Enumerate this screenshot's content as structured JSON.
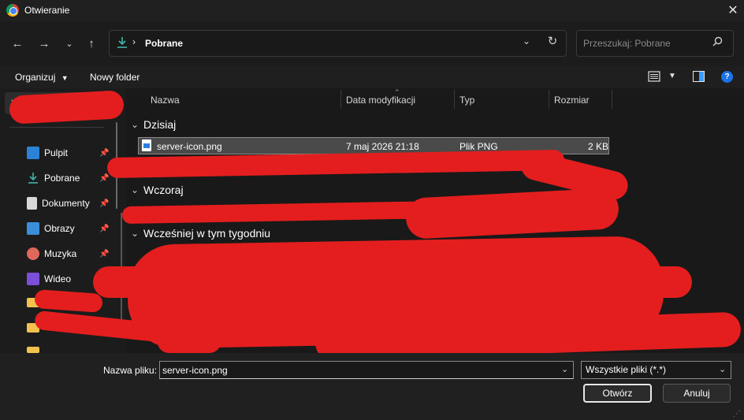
{
  "window": {
    "title": "Otwieranie"
  },
  "nav": {
    "back_icon": "arrow-left-icon",
    "forward_icon": "arrow-right-icon",
    "recent_icon": "chevron-down-icon",
    "up_icon": "arrow-up-icon"
  },
  "address": {
    "folder": "Pobrane",
    "icon": "download-icon"
  },
  "search": {
    "placeholder": "Przeszukaj: Pobrane"
  },
  "commands": {
    "organize": "Organizuj",
    "new_folder": "Nowy folder"
  },
  "sidebar": {
    "items": [
      {
        "label": "Pulpit",
        "icon": "desktop-icon",
        "pinned": true
      },
      {
        "label": "Pobrane",
        "icon": "download-icon",
        "pinned": true
      },
      {
        "label": "Dokumenty",
        "icon": "document-icon",
        "pinned": true
      },
      {
        "label": "Obrazy",
        "icon": "pictures-icon",
        "pinned": true
      },
      {
        "label": "Muzyka",
        "icon": "music-icon",
        "pinned": true
      },
      {
        "label": "Wideo",
        "icon": "video-icon",
        "pinned": false
      }
    ]
  },
  "columns": {
    "name": "Nazwa",
    "modified": "Data modyfikacji",
    "type": "Typ",
    "size": "Rozmiar"
  },
  "groups": {
    "today": "Dzisiaj",
    "yesterday": "Wczoraj",
    "this_week": "Wcześniej w tym tygodniu"
  },
  "files": [
    {
      "name": "server-icon.png",
      "modified": "7 maj 2026 21:18",
      "type": "Plik PNG",
      "size": "2 KB",
      "selected": true
    }
  ],
  "footer": {
    "filename_label": "Nazwa pliku:",
    "filename_value": "server-icon.png",
    "filetype": "Wszystkie pliki (*.*)",
    "open_label": "Otwórz",
    "cancel_label": "Anuluj"
  },
  "colors": {
    "redaction": "#e41e1e",
    "accent": "#3b9cff"
  }
}
